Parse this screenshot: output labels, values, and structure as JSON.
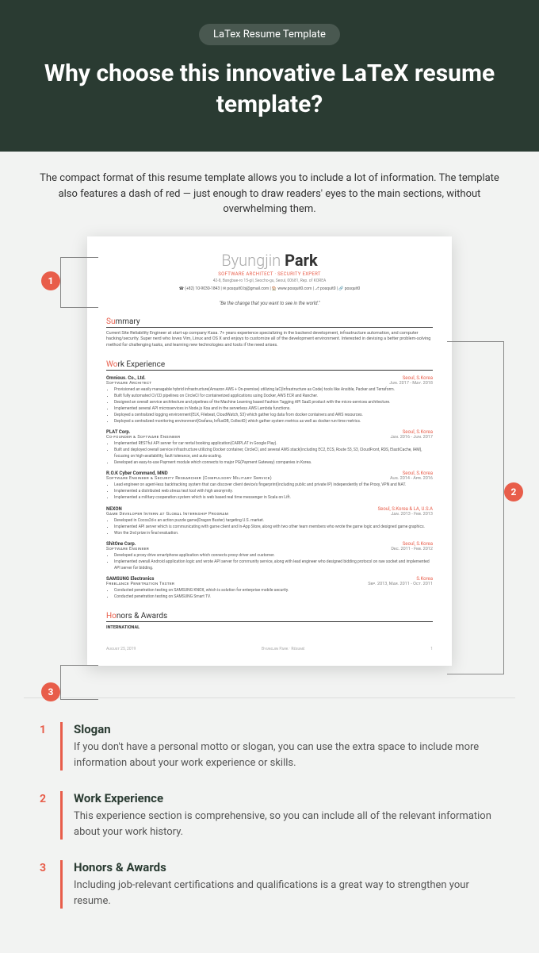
{
  "hero": {
    "pill": "LaTex Resume Template",
    "title": "Why choose this innovative LaTeX resume template?"
  },
  "intro": "The compact format of this resume template allows you to include a lot of information. The template also features a dash of red — just enough to draw readers' eyes to the main sections, without overwhelming them.",
  "resume": {
    "name_first": "Byungjin",
    "name_last": "Park",
    "subtitle": "SOFTWARE ARCHITECT · SECURITY EXPERT",
    "address": "42-8, Bangbae-ro 15-gil, Seocho-gu, Seoul, 00681, Rep. of KOREA",
    "contact": "☎ (+82) 10-9030-1843  |  ✉ posquit0.bj@gmail.com  |  🏠 www.posquit0.com  |  ⎇ posquit0  |  🔗 posquit0",
    "quote": "\"Be the change that you want to see in the world.\"",
    "summary_h1": "Su",
    "summary_h2": "mmary",
    "summary_body": "Current Site Reliability Engineer at start-up company Kasa. 7+ years experience specializing in the backend development, infrastructure automation, and computer hacking/security. Super nerd who loves Vim, Linux and OS X and enjoys to customize all of the development environment. Interested in devising a better problem-solving method for challenging tasks, and learning new technologies and tools if the need arises.",
    "work_h1": "Wo",
    "work_h2": "rk Experience",
    "honors_h1": "Ho",
    "honors_h2": "nors & Awards",
    "honors_sub": "INTERNATIONAL",
    "jobs": [
      {
        "name": "Omnious. Co., Ltd.",
        "loc": "Seoul, S.Korea",
        "role": "Software Architect",
        "date": "Jun. 2017 - May. 2018",
        "bullets": [
          "Provisioned an easily managable hybrid infrastructure(Amazon AWS + On-premise) utilizing IaC(Infrastructure as Code) tools like Ansible, Packer and Terraform.",
          "Built fully automated CI/CD pipelines on CircleCI for containerized applications using Docker, AWS ECR and Rancher.",
          "Designed an overall service architecture and pipelines of the Machine Learning based Fashion Tagging API SaaS product with the micro-services architecture.",
          "Implemented several API microservices in Node.js Koa and in the serverless AWS Lambda functions.",
          "Deployed a centralized logging environment(ELK, Filebeat, CloudWatch, S3) which gather log data from docker containers and AWS resources.",
          "Deployed a centralized monitoring environment(Grafana, InfluxDB, CollectD) which gather system metrics as well as docker run-time metrics."
        ]
      },
      {
        "name": "PLAT Corp.",
        "loc": "Seoul, S.Korea",
        "role": "Co-founder & Software Engineer",
        "date": "Jan. 2016 - Jun. 2017",
        "bullets": [
          "Implemented RESTful API server for car rental booking application(CARPLAT in Google Play).",
          "Built and deployed overall service infrastructure utilizing Docker container, CircleCI, and several AWS stack(including EC2, ECS, Route 53, S3, CloudFront, RDS, ElastiCache, IAM), focusing on high-availability, fault tolerance, and auto-scaling.",
          "Developed an easy-to-use Payment module which connects to major PG(Payment Gateway) companies in Korea."
        ]
      },
      {
        "name": "R.O.K Cyber Command, MND",
        "loc": "Seoul, S.Korea",
        "role": "Software Engineer & Security Researcher (Compulsory Military Service)",
        "date": "Aug. 2014 - Apr. 2016",
        "bullets": [
          "Lead engineer on agent-less backtracking system that can discover client device's fingerprint(including public and private IP) independently of the Proxy, VPN and NAT.",
          "Implemented a distributed web stress test tool with high anonymity.",
          "Implemented a military cooperation system which is web based real time messenger in Scala on Lift."
        ]
      },
      {
        "name": "NEXON",
        "loc": "Seoul, S.Korea & LA, U.S.A",
        "role": "Game Developer Intern at Global Internship Program",
        "date": "Jan. 2013 - Feb. 2013",
        "bullets": [
          "Developed in Cocos2d-x an action puzzle game(Dragon Buster) targeting U.S. market.",
          "Implemented API server which is communicating with game client and In-App Store, along with two other team members who wrote the game logic and designed game graphics.",
          "Won the 2nd prize in final evaluation."
        ]
      },
      {
        "name": "ShitOne Corp.",
        "loc": "Seoul, S.Korea",
        "role": "Software Engineer",
        "date": "Dec. 2011 - Feb. 2012",
        "bullets": [
          "Developed a proxy drive smartphone application which connects proxy driver and customer.",
          "Implemented overall Android application logic and wrote API server for community service, along with lead engineer who designed bidding protocol on raw socket and implemented API server for bidding."
        ]
      },
      {
        "name": "SAMSUNG Electronics",
        "loc": "S.Korea",
        "role": "Freelance Penetration Tester",
        "date": "Sep. 2013, Mar. 2011 - Oct. 2011",
        "bullets": [
          "Conducted penetration testing on SAMSUNG KNOX, which is solution for enterprise mobile security.",
          "Conducted penetration testing on SAMSUNG Smart TV."
        ]
      }
    ],
    "foot_left": "August 25, 2019",
    "foot_center": "Byungjin Park · Résumé",
    "foot_right": "1"
  },
  "markers": {
    "m1": "1",
    "m2": "2",
    "m3": "3"
  },
  "callouts": [
    {
      "num": "1",
      "title": "Slogan",
      "body": "If you don't have a personal motto or slogan, you can use the extra space to include more information about your work experience or skills."
    },
    {
      "num": "2",
      "title": "Work Experience",
      "body": "This experience section is comprehensive, so you can include all of the relevant information about your work history."
    },
    {
      "num": "3",
      "title": "Honors & Awards",
      "body": "Including job-relevant certifications and qualifications is a great way to strengthen your resume."
    }
  ]
}
